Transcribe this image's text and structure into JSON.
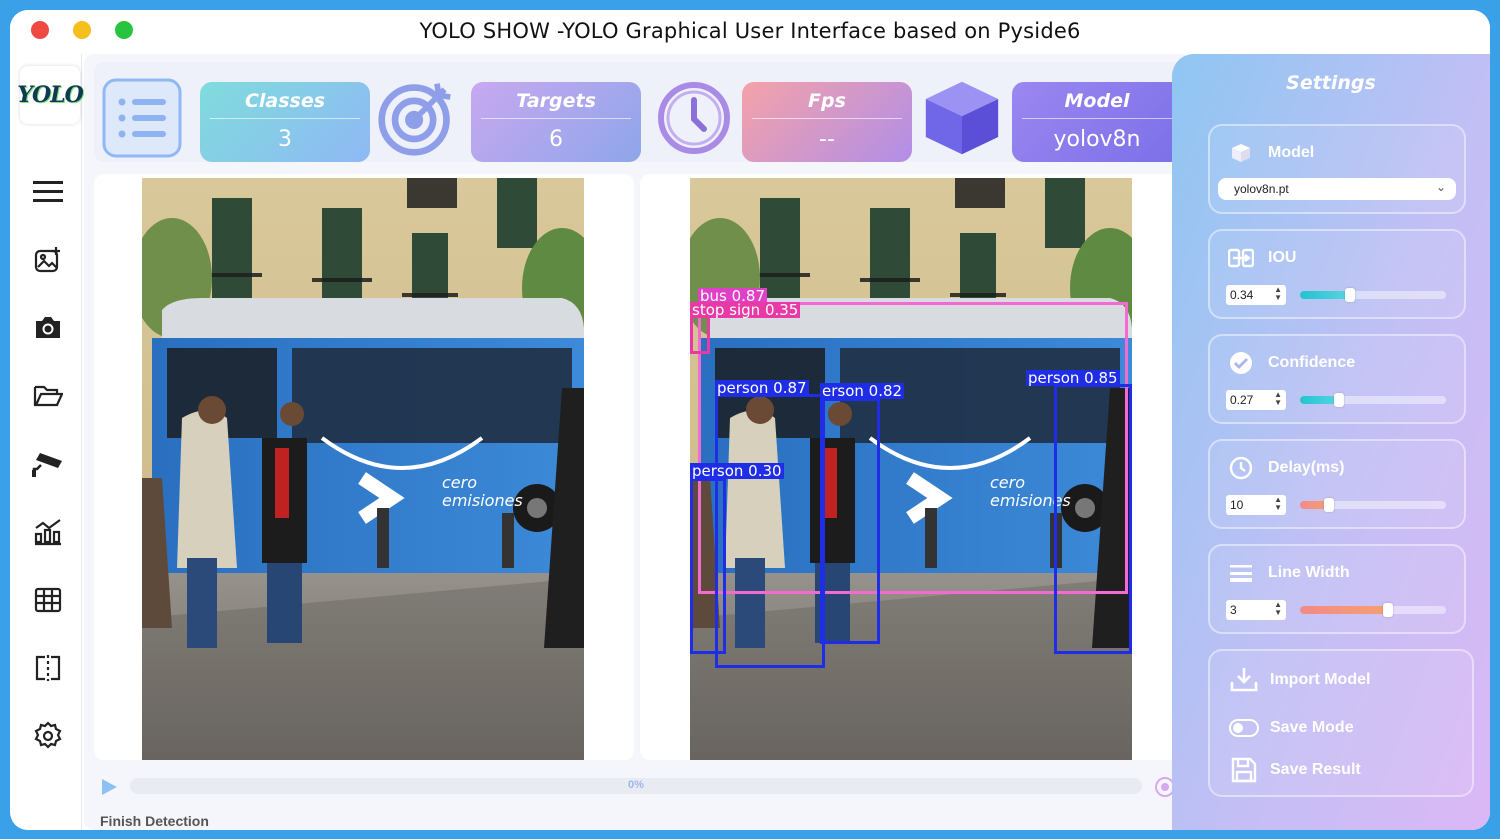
{
  "window": {
    "title": "YOLO SHOW -YOLO Graphical User Interface based on Pyside6"
  },
  "sidebar": {
    "logo_text": "YOLO",
    "items": [
      {
        "icon": "menu-icon"
      },
      {
        "icon": "image-add-icon"
      },
      {
        "icon": "camera-icon"
      },
      {
        "icon": "folder-open-icon"
      },
      {
        "icon": "cctv-icon"
      },
      {
        "icon": "chart-icon"
      },
      {
        "icon": "table-icon"
      },
      {
        "icon": "split-view-icon"
      },
      {
        "icon": "settings-gear-icon"
      }
    ]
  },
  "stats": {
    "classes": {
      "label": "Classes",
      "value": "3"
    },
    "targets": {
      "label": "Targets",
      "value": "6"
    },
    "fps": {
      "label": "Fps",
      "value": "--"
    },
    "model": {
      "label": "Model",
      "value": "yolov8n"
    }
  },
  "detections": [
    {
      "label": "bus  0.87",
      "color": "#e040c8"
    },
    {
      "label": "stop sign  0.35",
      "color": "#e83aa6"
    },
    {
      "label": "person  0.87",
      "color": "#1f2ee6"
    },
    {
      "label": "erson  0.82",
      "color": "#1f2ee6"
    },
    {
      "label": "person  0.85",
      "color": "#1f2ee6"
    },
    {
      "label": "person  0.30",
      "color": "#1f2ee6"
    }
  ],
  "progress": {
    "text": "0%",
    "value": 0
  },
  "status": "Finish Detection",
  "settings": {
    "title": "Settings",
    "model": {
      "label": "Model",
      "selected": "yolov8n.pt"
    },
    "iou": {
      "label": "IOU",
      "value": "0.34",
      "level": 0.34
    },
    "confidence": {
      "label": "Confidence",
      "value": "0.27",
      "level": 0.27
    },
    "delay": {
      "label": "Delay(ms)",
      "value": "10",
      "level": 0.2
    },
    "line_width": {
      "label": "Line Width",
      "value": "3",
      "level": 0.6
    },
    "import_model": "Import Model",
    "save_mode": "Save Mode",
    "save_result": "Save Result"
  },
  "colors": {
    "accent": "#8fb3ee",
    "iou_fill": "#2fc8d4",
    "delay_fill": "#f28a8a",
    "linewidth_fill": "#f5a070"
  }
}
